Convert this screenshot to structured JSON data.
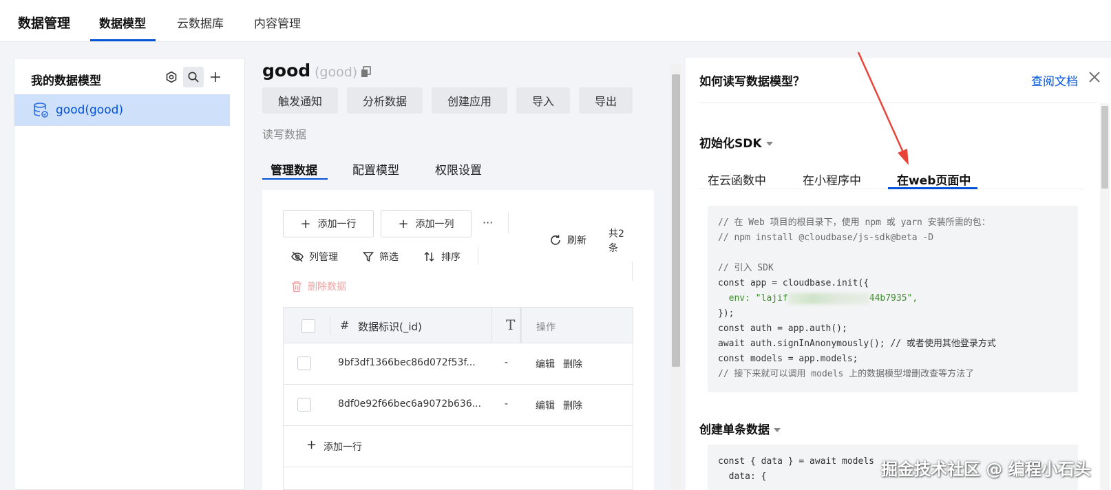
{
  "topbar": {
    "brand": "数据管理",
    "nav": [
      "数据模型",
      "云数据库",
      "内容管理"
    ]
  },
  "sidebar": {
    "title": "我的数据模型",
    "items": [
      {
        "label": "good(good)"
      }
    ]
  },
  "model": {
    "name": "good",
    "sub": "(good)",
    "actions": [
      "触发通知",
      "分析数据",
      "创建应用",
      "导入",
      "导出"
    ],
    "rw_label": "读写数据",
    "tabs": [
      "管理数据",
      "配置模型",
      "权限设置"
    ]
  },
  "toolbar": {
    "add_row": "添加一行",
    "add_col": "添加一列",
    "more": "···",
    "refresh": "刷新",
    "total": "共2条",
    "col_manage": "列管理",
    "filter": "筛选",
    "sort": "排序",
    "delete": "删除数据"
  },
  "table": {
    "headers": {
      "hash": "#",
      "id": "数据标识(_id)",
      "type": "T",
      "ops": "操作"
    },
    "rows": [
      {
        "id": "9bf3df1366bec86d072f53f...",
        "value": "-",
        "edit": "编辑",
        "del": "删除"
      },
      {
        "id": "8df0e92f66bec6a9072b636...",
        "value": "-",
        "edit": "编辑",
        "del": "删除"
      }
    ],
    "add_row": "添加一行"
  },
  "panel": {
    "heading": "如何读写数据模型？",
    "doc_link": "查阅文档",
    "section_init": "初始化SDK",
    "sdk_tabs": [
      "在云函数中",
      "在小程序中",
      "在web页面中"
    ],
    "section_create": "创建单条数据",
    "code_lines": [
      "// 在 Web 项目的根目录下，使用 npm 或 yarn 安装所需的包：",
      "// npm install @cloudbase/js-sdk@beta -D",
      "// 引入 SDK",
      "const app = cloudbase.init({",
      "env: \"lajif",
      "44b7935\",",
      "});",
      "const auth = app.auth();",
      "await auth.signInAnonymously(); // 或者使用其他登录方式",
      "const models = app.models;",
      "// 接下来就可以调用 models 上的数据模型增删改查等方法了",
      "const { data } = await models",
      "data: {"
    ]
  },
  "watermark": "掘金技术社区 @ 编程小石头",
  "colors": {
    "accent": "#0052d9",
    "danger": "#e34d59",
    "selected_bg": "#cfe0fa",
    "arrow": "#e8443a"
  }
}
